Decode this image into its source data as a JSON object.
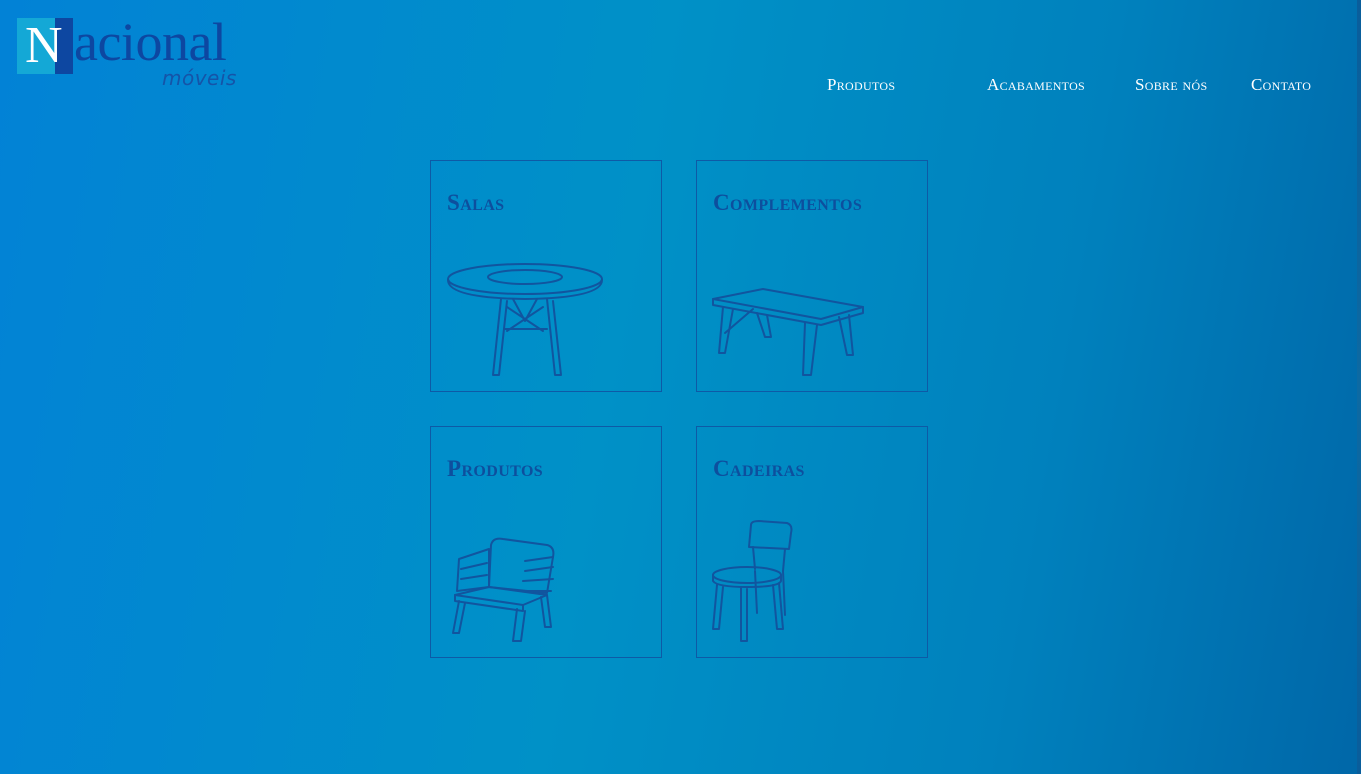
{
  "brand": {
    "logo_letter": "N",
    "logo_word": "acional",
    "logo_sub": "móveis"
  },
  "nav": {
    "items": [
      {
        "label": "Produtos"
      },
      {
        "label": "Acabamentos"
      },
      {
        "label": "Sobre nós"
      },
      {
        "label": "Contato"
      }
    ]
  },
  "categories": [
    {
      "title": "Salas",
      "icon": "round-table-icon"
    },
    {
      "title": "Complementos",
      "icon": "coffee-table-icon"
    },
    {
      "title": "Produtos",
      "icon": "armchair-icon"
    },
    {
      "title": "Cadeiras",
      "icon": "chair-icon"
    }
  ],
  "colors": {
    "background_start": "#0282d6",
    "background_end": "#0067a8",
    "nav_text": "#ffffff",
    "card_text": "#0d4f9e",
    "logo_dark": "#0d47a1",
    "logo_light": "#14a8d6"
  }
}
